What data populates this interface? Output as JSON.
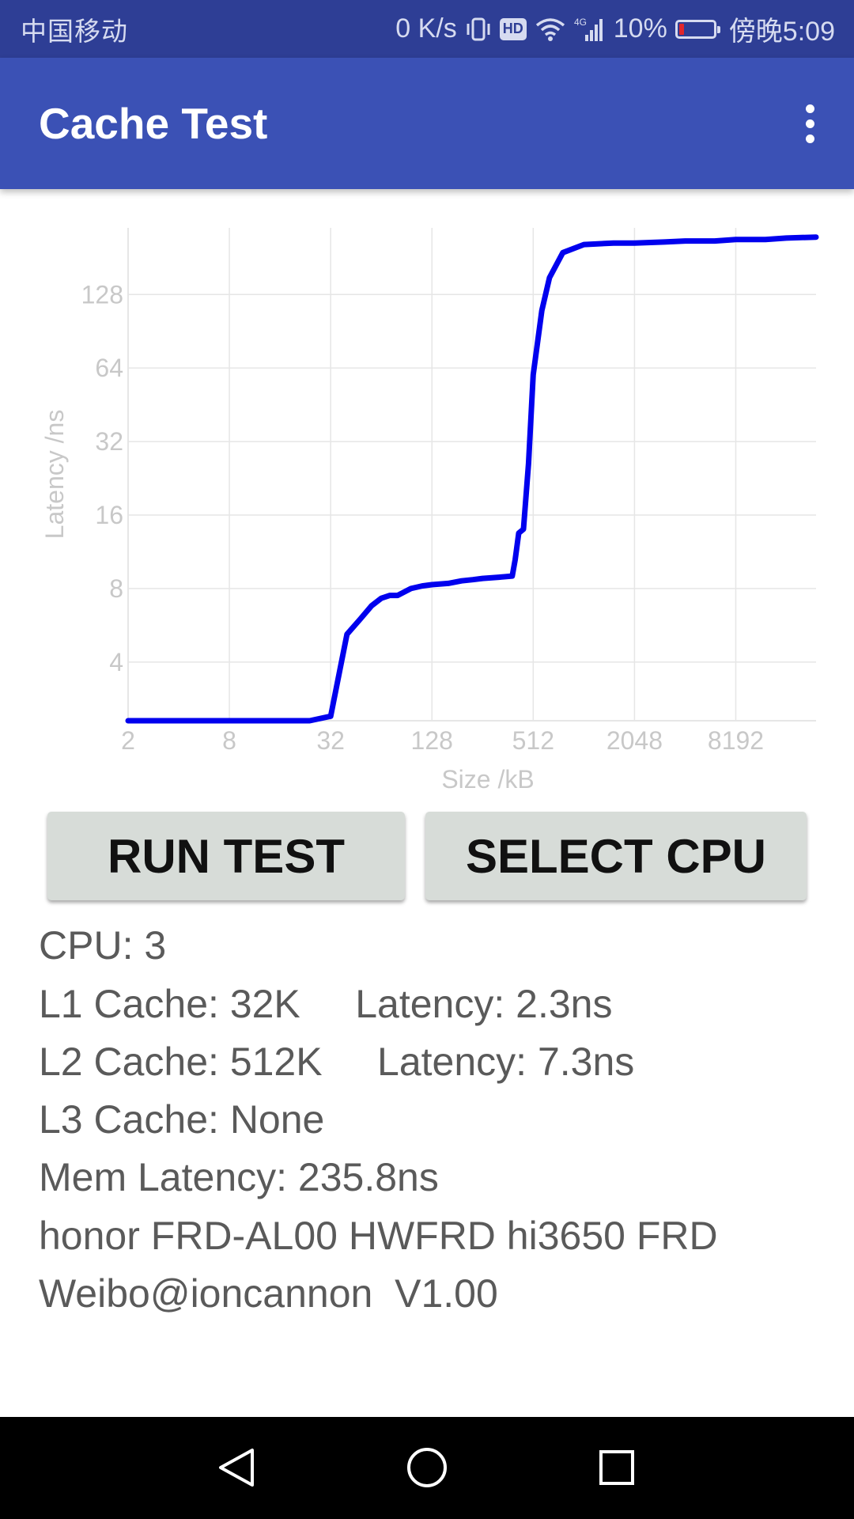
{
  "status_bar": {
    "carrier": "中国移动",
    "net_speed": "0 K/s",
    "hd_label": "HD",
    "network_type": "4G",
    "battery": "10%",
    "time": "傍晚5:09",
    "battery_color": "#e0262b"
  },
  "app_bar": {
    "title": "Cache Test",
    "menu_icon": "more-vert-icon",
    "color": "#3b51b5"
  },
  "chart_data": {
    "type": "line",
    "xlabel": "Size /kB",
    "ylabel": "Latency /ns",
    "x_scale": "log2",
    "y_scale": "log2",
    "xlim": [
      2,
      24576
    ],
    "ylim": [
      2.3,
      240
    ],
    "x_ticks": [
      "2",
      "8",
      "32",
      "128",
      "512",
      "2048",
      "8192"
    ],
    "y_ticks": [
      "4",
      "8",
      "16",
      "32",
      "64",
      "128"
    ],
    "grid": true,
    "series": [
      {
        "color": "#0000ee",
        "x": [
          2,
          4,
          8,
          16,
          24,
          32,
          36,
          40,
          48,
          56,
          64,
          72,
          80,
          96,
          112,
          128,
          160,
          192,
          224,
          256,
          320,
          384,
          400,
          420,
          448,
          480,
          512,
          576,
          640,
          768,
          1024,
          1536,
          2048,
          3072,
          4096,
          6144,
          8192,
          12288,
          16384,
          24576
        ],
        "y": [
          2.3,
          2.3,
          2.3,
          2.3,
          2.3,
          2.4,
          3.6,
          5.2,
          6.0,
          6.8,
          7.3,
          7.5,
          7.5,
          8.0,
          8.2,
          8.3,
          8.4,
          8.6,
          8.7,
          8.8,
          8.9,
          9.0,
          10.5,
          13.5,
          14.0,
          26.0,
          60.0,
          110.0,
          150.0,
          190.0,
          205.0,
          208.0,
          208.0,
          210.0,
          212.0,
          212.0,
          215.0,
          215.0,
          218.0,
          220.0
        ]
      }
    ]
  },
  "buttons": {
    "run_test": "RUN TEST",
    "select_cpu": "SELECT CPU"
  },
  "results": {
    "cpu": "CPU: 3",
    "l1": "L1 Cache: 32K     Latency: 2.3ns",
    "l2": "L2 Cache: 512K     Latency: 7.3ns",
    "l3": "L3 Cache: None",
    "mem": "Mem Latency: 235.8ns",
    "device": "honor FRD-AL00 HWFRD hi3650 FRD",
    "credit": "Weibo@ioncannon  V1.00"
  },
  "nav_bar": {
    "back_icon": "back-triangle-icon",
    "home_icon": "home-circle-icon",
    "recents_icon": "recents-square-icon"
  }
}
